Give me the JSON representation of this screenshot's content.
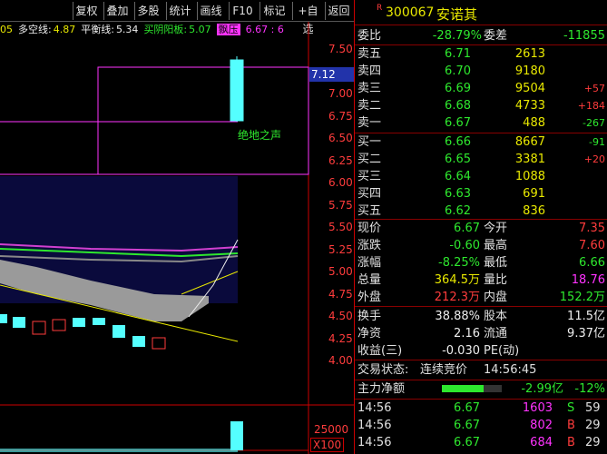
{
  "toolbar": {
    "buttons": [
      "复权",
      "叠加",
      "多股",
      "统计",
      "画线",
      "F10",
      "标记",
      "+自选",
      "返回"
    ]
  },
  "indicators": {
    "first": "05",
    "duokong_label": "多空线:",
    "duokong_value": "4.87",
    "pingheng_label": "平衡线:",
    "pingheng_value": "5.34",
    "maiyin_label": "买阴阳板:",
    "maiyin_value": "5.07",
    "piaoya_label": "飘压",
    "piaoya_value": "6.67 : 6"
  },
  "price_axis": [
    "7.50",
    "7.25",
    "7.00",
    "6.75",
    "6.50",
    "6.25",
    "6.00",
    "5.75",
    "5.50",
    "5.25",
    "5.00",
    "4.75",
    "4.50",
    "4.25",
    "4.00"
  ],
  "price_current": "7.12",
  "annotation": "绝地之声",
  "volume_axis": {
    "v25000": "25000",
    "x100": "X100"
  },
  "stock": {
    "r_mark": "R",
    "code": "300067",
    "name": "安诺其"
  },
  "weibi": {
    "label": "委比",
    "value": "-28.79%",
    "label2": "委差",
    "value2": "-11855"
  },
  "asks": [
    {
      "label": "卖五",
      "price": "6.71",
      "vol": "2613",
      "chg": ""
    },
    {
      "label": "卖四",
      "price": "6.70",
      "vol": "9180",
      "chg": ""
    },
    {
      "label": "卖三",
      "price": "6.69",
      "vol": "9504",
      "chg": "+57"
    },
    {
      "label": "卖二",
      "price": "6.68",
      "vol": "4733",
      "chg": "+184"
    },
    {
      "label": "卖一",
      "price": "6.67",
      "vol": "488",
      "chg": "-267"
    }
  ],
  "bids": [
    {
      "label": "买一",
      "price": "6.66",
      "vol": "8667",
      "chg": "-91"
    },
    {
      "label": "买二",
      "price": "6.65",
      "vol": "3381",
      "chg": "+20"
    },
    {
      "label": "买三",
      "price": "6.64",
      "vol": "1088",
      "chg": ""
    },
    {
      "label": "买四",
      "price": "6.63",
      "vol": "691",
      "chg": ""
    },
    {
      "label": "买五",
      "price": "6.62",
      "vol": "836",
      "chg": ""
    }
  ],
  "stats": [
    {
      "l1": "现价",
      "v1": "6.67",
      "l2": "今开",
      "v2": "7.35"
    },
    {
      "l1": "涨跌",
      "v1": "-0.60",
      "l2": "最高",
      "v2": "7.60"
    },
    {
      "l1": "涨幅",
      "v1": "-8.25%",
      "l2": "最低",
      "v2": "6.66"
    },
    {
      "l1": "总量",
      "v1": "364.5万",
      "l2": "量比",
      "v2": "18.76"
    },
    {
      "l1": "外盘",
      "v1": "212.3万",
      "l2": "内盘",
      "v2": "152.2万"
    }
  ],
  "stats2": [
    {
      "l1": "换手",
      "v1": "38.88%",
      "l2": "股本",
      "v2": "11.5亿"
    },
    {
      "l1": "净资",
      "v1": "2.16",
      "l2": "流通",
      "v2": "9.37亿"
    },
    {
      "l1": "收益(三)",
      "v1": "-0.030",
      "l2": "PE(动)",
      "v2": ""
    }
  ],
  "trade_status": {
    "label": "交易状态:",
    "value": "连续竞价",
    "time": "14:56:45"
  },
  "net_flow": {
    "label": "主力净额",
    "value": "-2.99亿",
    "pct": "-12%",
    "bar_fraction": 0.7
  },
  "ticks": [
    {
      "time": "14:56",
      "price": "6.67",
      "vol": "1603",
      "side": "S",
      "num": "59"
    },
    {
      "time": "14:56",
      "price": "6.67",
      "vol": "802",
      "side": "B",
      "num": "29"
    },
    {
      "time": "14:56",
      "price": "6.67",
      "vol": "684",
      "side": "B",
      "num": "29"
    }
  ],
  "colors": {
    "up": "#ff3c3c",
    "down": "#2ee82e",
    "frame": "#cc0000",
    "candle_down": "#54ffff",
    "magenta": "#ff33ff"
  }
}
